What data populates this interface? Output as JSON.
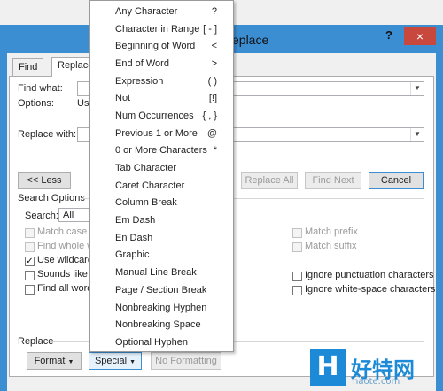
{
  "window": {
    "title_visible": "eplace",
    "help_glyph": "?",
    "close_glyph": "×"
  },
  "tabs": [
    {
      "label": "Find"
    },
    {
      "label": "Replace"
    }
  ],
  "find": {
    "label": "Find what:",
    "value": ""
  },
  "options": {
    "label": "Options:",
    "value_visible": "Use"
  },
  "replace_with": {
    "label": "Replace with:",
    "value": ""
  },
  "buttons": {
    "less": "<< Less",
    "replace_all": "Replace All",
    "find_next": "Find Next",
    "cancel": "Cancel",
    "format": "Format",
    "special": "Special",
    "no_formatting": "No Formatting"
  },
  "search_options": {
    "title": "Search Options",
    "search_label": "Search:",
    "search_value": "All",
    "left": [
      {
        "label": "Match case",
        "checked": false,
        "disabled": true
      },
      {
        "label": "Find whole w",
        "checked": false,
        "disabled": true
      },
      {
        "label": "Use wildcard",
        "checked": true,
        "disabled": false
      },
      {
        "label": "Sounds like (",
        "checked": false,
        "disabled": false
      },
      {
        "label": "Find all word",
        "checked": false,
        "disabled": false
      }
    ],
    "right": [
      {
        "label": "Match prefix",
        "checked": false,
        "disabled": true
      },
      {
        "label": "Match suffix",
        "checked": false,
        "disabled": true
      },
      {
        "label": "Ignore punctuation characters",
        "checked": false,
        "disabled": false
      },
      {
        "label": "Ignore white-space characters",
        "checked": false,
        "disabled": false
      }
    ]
  },
  "replace_section": {
    "title": "Replace"
  },
  "special_menu": [
    {
      "label": "Any Character",
      "shortcut": "?"
    },
    {
      "label": "Character in Range",
      "shortcut": "[ - ]"
    },
    {
      "label": "Beginning of Word",
      "shortcut": "<"
    },
    {
      "label": "End of Word",
      "shortcut": ">"
    },
    {
      "label": "Expression",
      "shortcut": "( )"
    },
    {
      "label": "Not",
      "shortcut": "[!]"
    },
    {
      "label": "Num Occurrences",
      "shortcut": "{ , }"
    },
    {
      "label": "Previous 1 or More",
      "shortcut": "@"
    },
    {
      "label": "0 or More Characters",
      "shortcut": "*"
    },
    {
      "label": "Tab Character",
      "shortcut": ""
    },
    {
      "label": "Caret Character",
      "shortcut": ""
    },
    {
      "label": "Column Break",
      "shortcut": ""
    },
    {
      "label": "Em Dash",
      "shortcut": ""
    },
    {
      "label": "En Dash",
      "shortcut": ""
    },
    {
      "label": "Graphic",
      "shortcut": ""
    },
    {
      "label": "Manual Line Break",
      "shortcut": ""
    },
    {
      "label": "Page / Section Break",
      "shortcut": ""
    },
    {
      "label": "Nonbreaking Hyphen",
      "shortcut": ""
    },
    {
      "label": "Nonbreaking Space",
      "shortcut": ""
    },
    {
      "label": "Optional Hyphen",
      "shortcut": ""
    }
  ],
  "watermark": {
    "logo_glyph": "H",
    "text": "好特网",
    "url": "haote.com"
  },
  "colors": {
    "accent": "#3c8ed3",
    "close": "#c9483d",
    "watermark": "#1c8ad6"
  }
}
